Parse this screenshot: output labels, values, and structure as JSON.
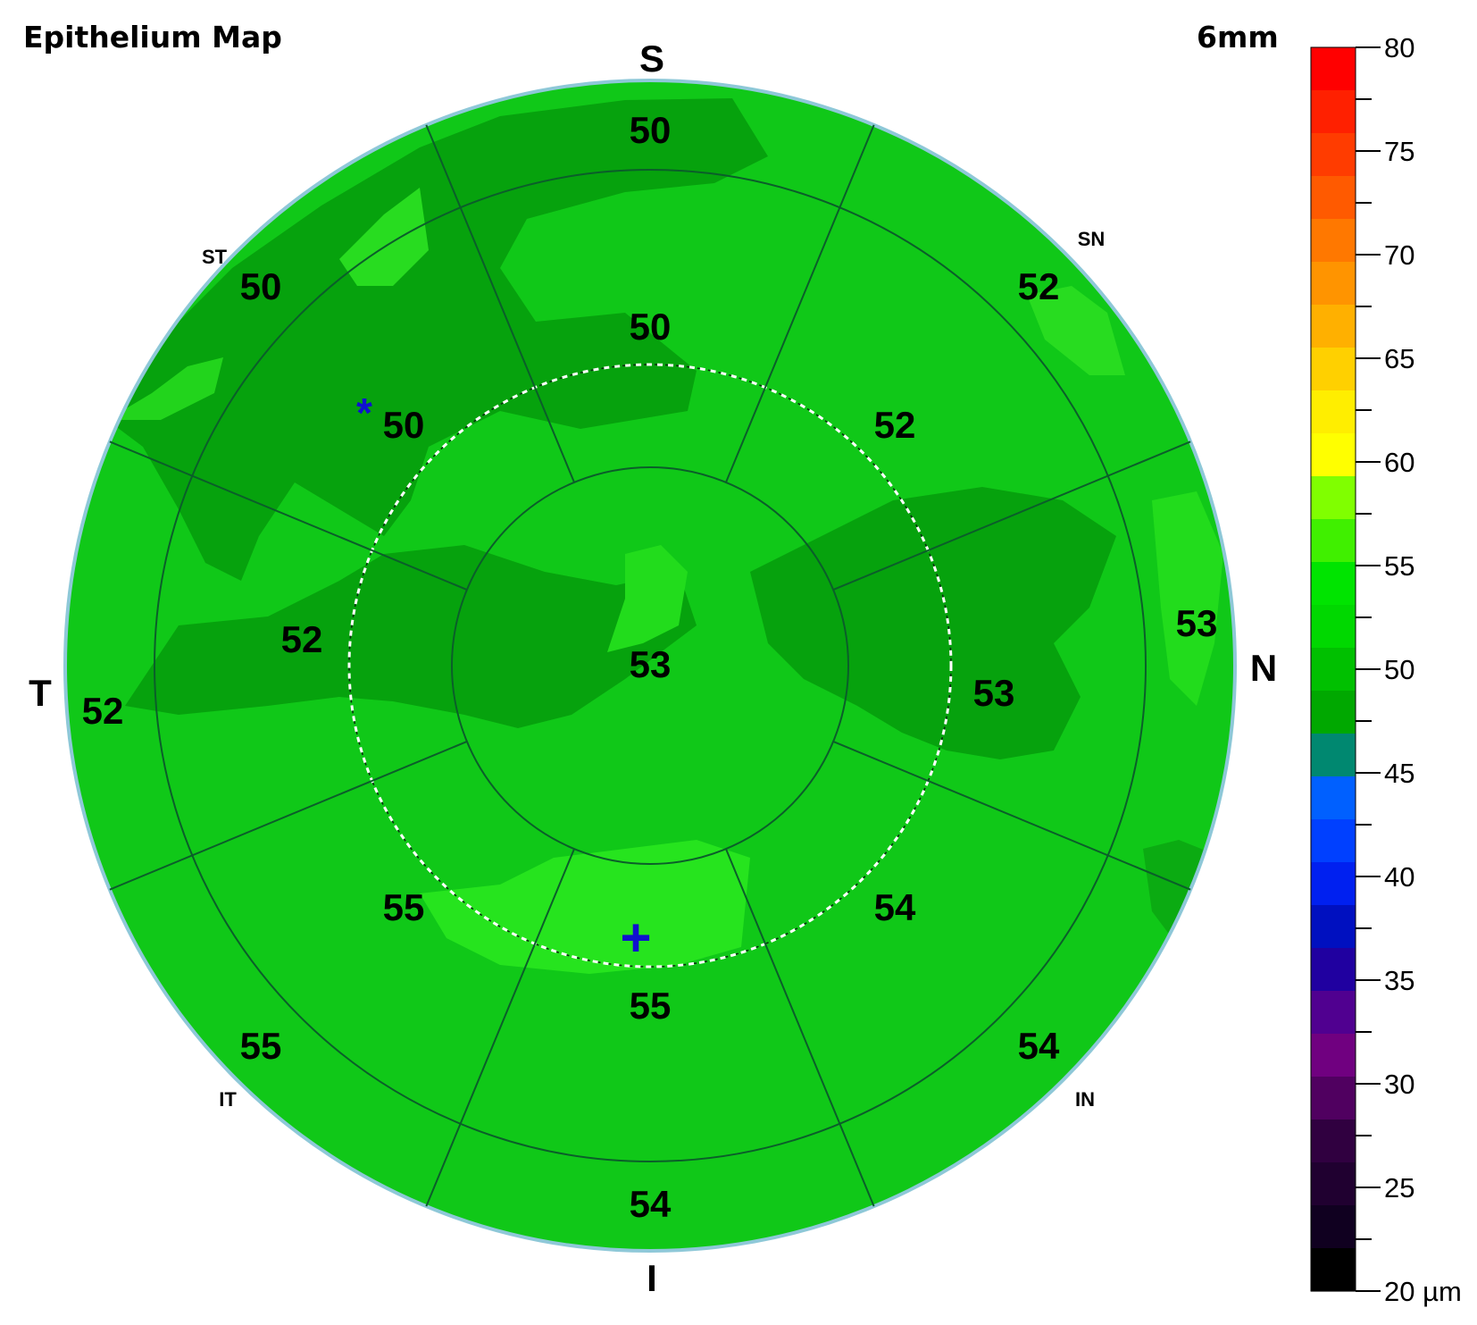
{
  "map": {
    "title": "Epithelium Map",
    "diameter_label": "6mm"
  },
  "orientation": {
    "superior": "S",
    "inferior": "I",
    "temporal": "T",
    "nasal": "N",
    "superotemporal": "ST",
    "superonasal": "SN",
    "inferotemporal": "IT",
    "inferonasal": "IN"
  },
  "sectors": {
    "center": "53",
    "paracentral": {
      "S": "50",
      "SN": "52",
      "N": "53",
      "IN": "54",
      "I": "55",
      "IT": "55",
      "T": "52",
      "ST": "50"
    },
    "mid": {
      "S": "50",
      "SN": "52",
      "N": "53",
      "IN": "54",
      "I": "54",
      "IT": "55",
      "T": "52",
      "ST": "50"
    }
  },
  "markers": {
    "min_marker": "*",
    "max_marker": "+"
  },
  "colorbar": {
    "tick_labels": [
      "80",
      "75",
      "70",
      "65",
      "60",
      "55",
      "50",
      "45",
      "40",
      "35",
      "30",
      "25",
      "20 µm"
    ],
    "colors": [
      "#ff0000",
      "#ff2000",
      "#ff3c00",
      "#ff5a00",
      "#ff7800",
      "#ff9400",
      "#ffb000",
      "#ffd000",
      "#ffee00",
      "#ffff00",
      "#80ff00",
      "#40f000",
      "#00e400",
      "#00d800",
      "#00c000",
      "#00a800",
      "#008870",
      "#0060ff",
      "#0040ff",
      "#0020f0",
      "#0010c0",
      "#2000a0",
      "#500090",
      "#700080",
      "#500060",
      "#300040",
      "#200030",
      "#100020",
      "#000000"
    ]
  },
  "colors": {
    "base_green": "#10c818",
    "dark_green": "#06a20d",
    "light_green": "#22e01c",
    "grid_line": "#0b5e2a",
    "outer_rim": "#8ec8d8",
    "marker_blue": "#1010d0"
  }
}
